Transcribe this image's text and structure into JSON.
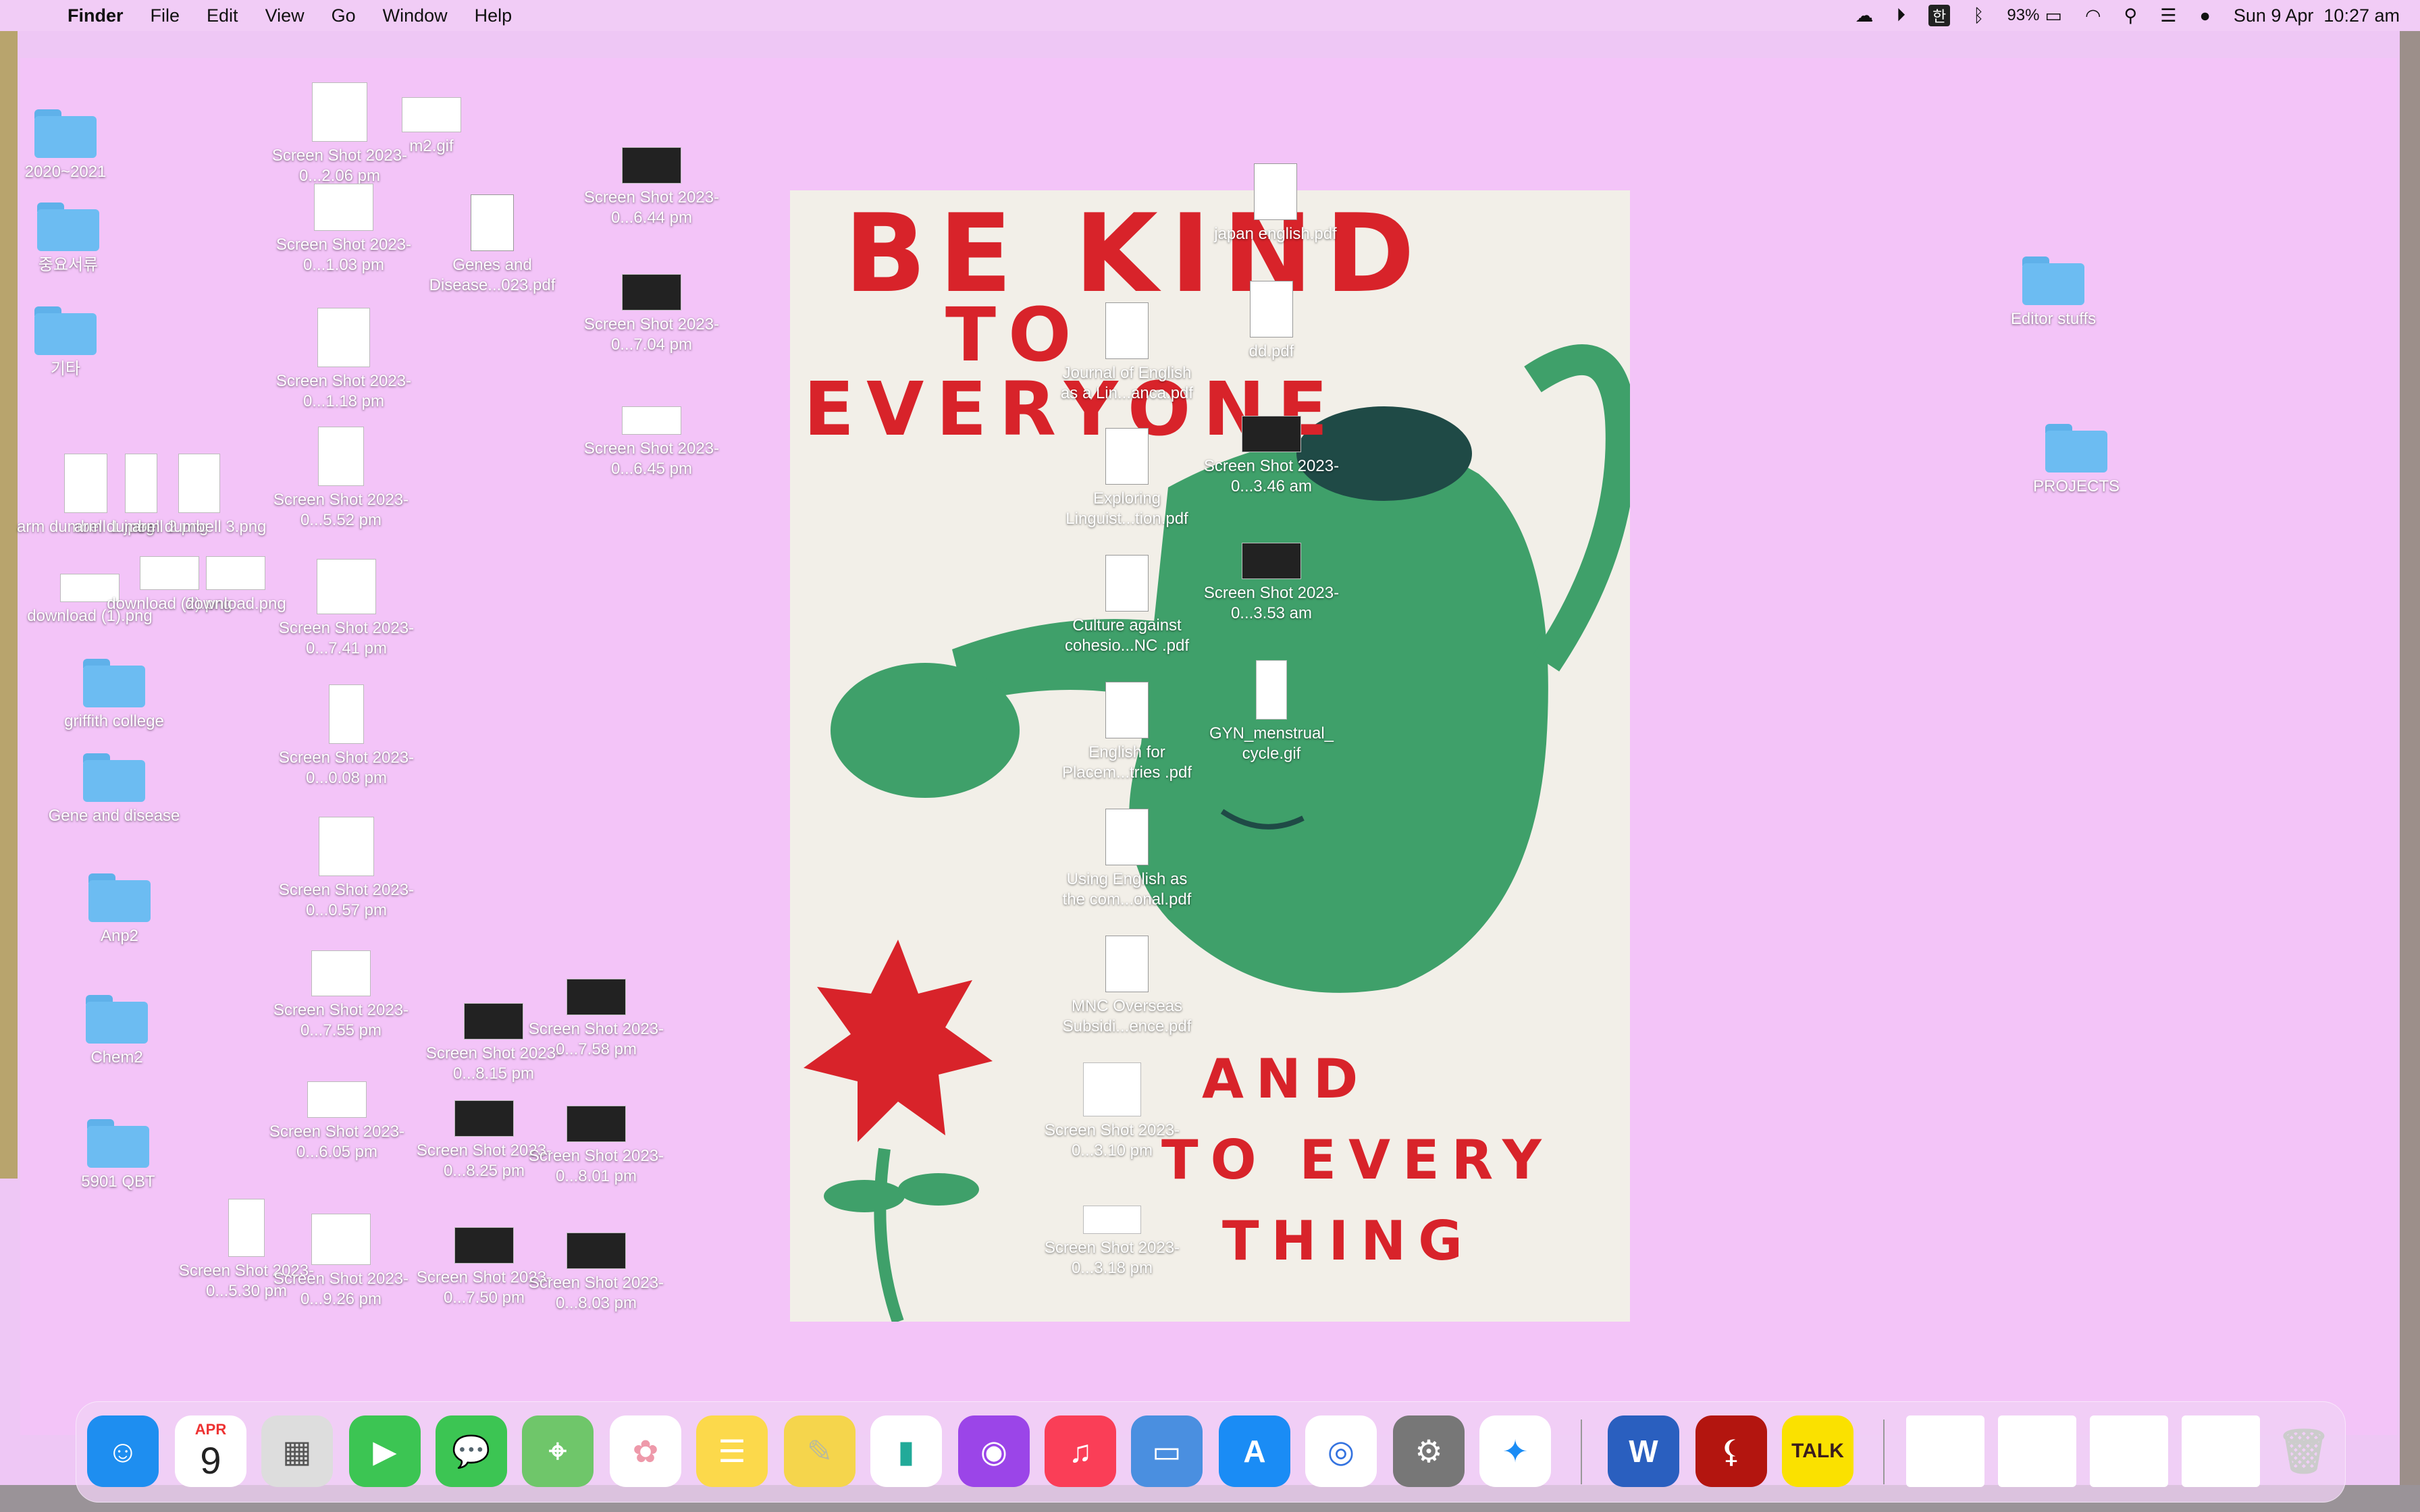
{
  "menubar": {
    "app": "Finder",
    "items": [
      "File",
      "Edit",
      "View",
      "Go",
      "Window",
      "Help"
    ],
    "battery": "93%",
    "datetime": "Sun 9 Apr  10:27 am",
    "ime": "한"
  },
  "poster": {
    "line1": "BE KIND",
    "line2": "TO",
    "line3": "EVERYONE",
    "line4": "AND",
    "line5": "TO EVERY",
    "line6": "THING"
  },
  "desktop": {
    "folders": [
      {
        "label": "2020~2021"
      },
      {
        "label": "중요서류"
      },
      {
        "label": "기타"
      },
      {
        "label": "griffith college"
      },
      {
        "label": "Gene and disease"
      },
      {
        "label": "Anp2"
      },
      {
        "label": "Chem2"
      },
      {
        "label": "5901 QBT"
      },
      {
        "label": "Editor stuffs"
      },
      {
        "label": "PROJECTS"
      }
    ],
    "files": [
      {
        "label": "Screen Shot 2023-0...2.06 pm"
      },
      {
        "label": "m2.gif"
      },
      {
        "label": "Screen Shot 2023-0...1.03 pm"
      },
      {
        "label": "Genes and Disease...023.pdf"
      },
      {
        "label": "Screen Shot 2023-0...1.18 pm"
      },
      {
        "label": "Screen Shot 2023-0...5.52 pm"
      },
      {
        "label": "Screen Shot 2023-0...7.41 pm"
      },
      {
        "label": "Screen Shot 2023-0...0.08 pm"
      },
      {
        "label": "Screen Shot 2023-0...0.57 pm"
      },
      {
        "label": "Screen Shot 2023-0...7.55 pm"
      },
      {
        "label": "Screen Shot 2023-0...6.05 pm"
      },
      {
        "label": "Screen Shot 2023-0...5.30 pm"
      },
      {
        "label": "Screen Shot 2023-0...9.26 pm"
      },
      {
        "label": "Screen Shot 2023-0...6.44 pm"
      },
      {
        "label": "Screen Shot 2023-0...7.04 pm"
      },
      {
        "label": "Screen Shot 2023-0...6.45 pm"
      },
      {
        "label": "arm dumbell 1.jpeg"
      },
      {
        "label": "arm dumbell 2.png"
      },
      {
        "label": "arm dumbell 3.png"
      },
      {
        "label": "download (1).png"
      },
      {
        "label": "download (2).png"
      },
      {
        "label": "download.png"
      },
      {
        "label": "Screen Shot 2023-0...8.15 pm"
      },
      {
        "label": "Screen Shot 2023-0...7.58 pm"
      },
      {
        "label": "Screen Shot 2023-0...8.25 pm"
      },
      {
        "label": "Screen Shot 2023-0...8.01 pm"
      },
      {
        "label": "Screen Shot 2023-0...7.50 pm"
      },
      {
        "label": "Screen Shot 2023-0...8.03 pm"
      },
      {
        "label": "Journal of English as a Lin...anca.pdf"
      },
      {
        "label": "Exploring Linguist...tion.pdf"
      },
      {
        "label": "Culture against cohesio...NC .pdf"
      },
      {
        "label": "English for Placem...tries .pdf"
      },
      {
        "label": "Using English as the com...onal.pdf"
      },
      {
        "label": "MNC Overseas Subsidi...ence.pdf"
      },
      {
        "label": "Screen Shot 2023-0...3.10 pm"
      },
      {
        "label": "Screen Shot 2023-0...3.18 pm"
      },
      {
        "label": "japan english.pdf"
      },
      {
        "label": "dd.pdf"
      },
      {
        "label": "Screen Shot 2023-0...3.46 am"
      },
      {
        "label": "Screen Shot 2023-0...3.53 am"
      },
      {
        "label": "GYN_menstrual_ cycle.gif"
      }
    ]
  },
  "dock": {
    "calendar_month": "APR",
    "calendar_day": "9",
    "word_label": "W",
    "talk_label": "TALK",
    "items": [
      "Finder",
      "Calendar",
      "Launchpad",
      "FaceTime",
      "Messages",
      "Maps",
      "Photos",
      "Notes",
      "Stickies",
      "Numbers",
      "Podcasts",
      "Music",
      "Keynote",
      "App Store",
      "Chrome",
      "System Preferences",
      "Safari",
      "Microsoft Word",
      "Adobe Acrobat",
      "KakaoTalk",
      "Trash"
    ]
  }
}
